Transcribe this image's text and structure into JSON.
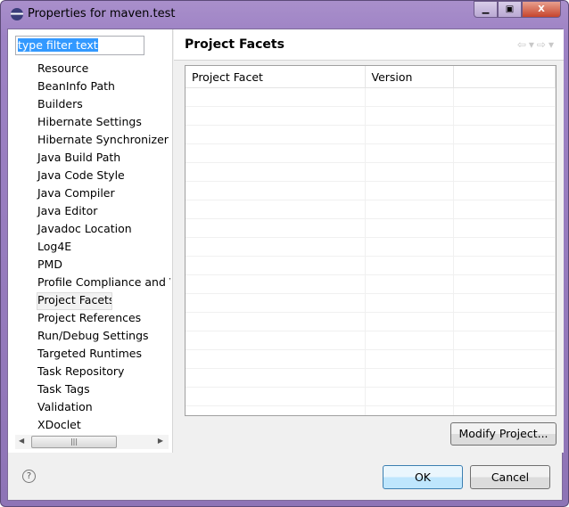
{
  "window": {
    "title": "Properties for maven.test",
    "buttons": [
      "minimize",
      "maximize",
      "close"
    ]
  },
  "filter": {
    "value": "type filter text"
  },
  "tree": {
    "items": [
      "Resource",
      "BeanInfo Path",
      "Builders",
      "Hibernate Settings",
      "Hibernate Synchronizer",
      "Java Build Path",
      "Java Code Style",
      "Java Compiler",
      "Java Editor",
      "Javadoc Location",
      "Log4E",
      "PMD",
      "Profile Compliance and Validation",
      "Project Facets",
      "Project References",
      "Run/Debug Settings",
      "Targeted Runtimes",
      "Task Repository",
      "Task Tags",
      "Validation",
      "XDoclet"
    ],
    "selected": "Project Facets"
  },
  "page": {
    "title": "Project Facets",
    "columns": [
      "Project Facet",
      "Version",
      ""
    ],
    "rows": [],
    "modify_label": "Modify Project..."
  },
  "footer": {
    "ok_label": "OK",
    "cancel_label": "Cancel"
  }
}
